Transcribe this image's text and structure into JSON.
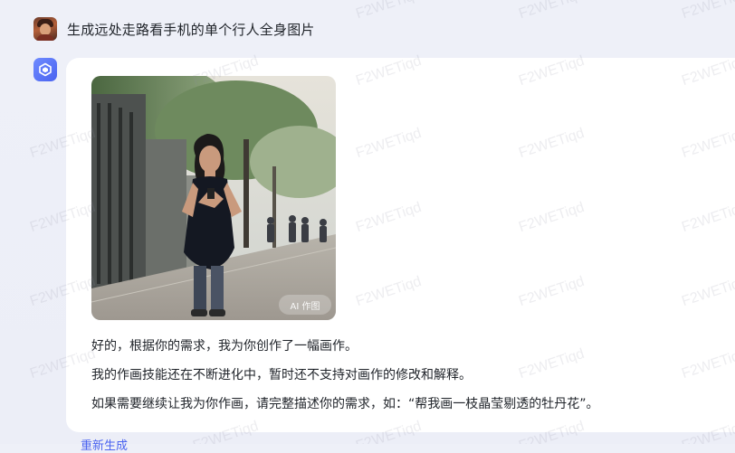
{
  "user_message": {
    "text": "生成远处走路看手机的单个行人全身图片"
  },
  "assistant": {
    "image_badge": "AI 作图",
    "reply_lines": [
      "好的，根据你的需求，我为你创作了一幅画作。",
      "我的作画技能还在不断进化中，暂时还不支持对画作的修改和解释。",
      "如果需要继续让我为你作画，请完整描述你的需求，如：“帮我画一枝晶莹剔透的牡丹花”。"
    ],
    "regenerate_label": "重新生成"
  },
  "watermark": {
    "text": "F2WETiqd"
  },
  "colors": {
    "accent": "#4a63f0",
    "background": "#eef0f8",
    "card": "#ffffff",
    "text": "#1f2329"
  }
}
